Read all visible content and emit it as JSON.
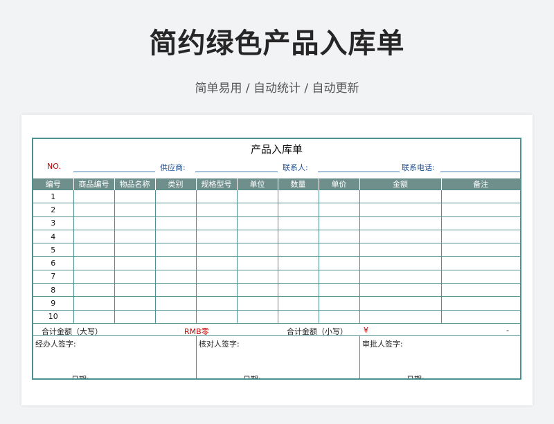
{
  "page": {
    "title": "简约绿色产品入库单",
    "subtitle": "简单易用 / 自动统计 / 自动更新"
  },
  "form": {
    "title": "产品入库单",
    "info": {
      "no_label": "NO.",
      "supplier_label": "供应商:",
      "contact_label": "联系人:",
      "phone_label": "联系电话:"
    },
    "columns": [
      "编号",
      "商品编号",
      "物品名称",
      "类别",
      "规格型号",
      "单位",
      "数量",
      "单价",
      "金额",
      "备注"
    ],
    "rows": [
      "1",
      "2",
      "3",
      "4",
      "5",
      "6",
      "7",
      "8",
      "9",
      "10"
    ],
    "totals": {
      "upper_label": "合计金额（大写）",
      "upper_value": "RMB零",
      "lower_label": "合计金额（小写）",
      "currency": "¥",
      "lower_value": "-"
    },
    "signatures": {
      "handler": "经办人签字:",
      "checker": "核对人签字:",
      "approver": "审批人签字:",
      "date_label": "日期:"
    }
  },
  "colors": {
    "header_bg": "#6f8f8c",
    "border": "#4e8f8f",
    "label_blue": "#1f4f99",
    "accent_red": "#c00000"
  }
}
